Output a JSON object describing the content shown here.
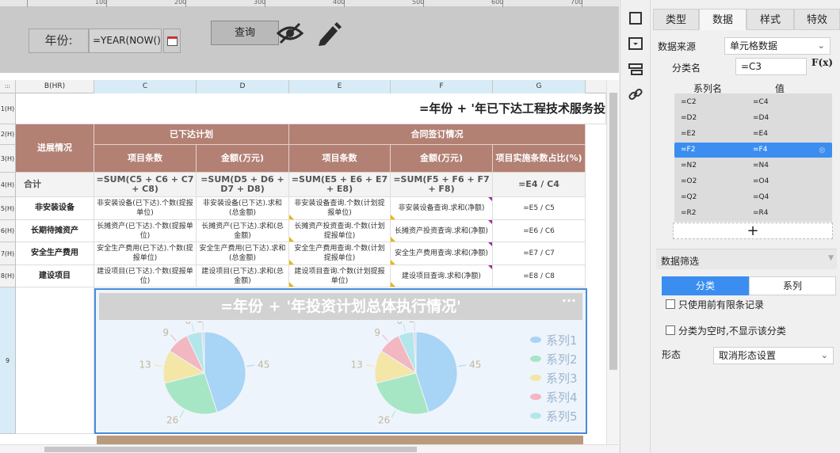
{
  "ruler": {
    "labels": [
      "100",
      "200",
      "300",
      "400",
      "500",
      "600",
      "700"
    ]
  },
  "param": {
    "label": "年份:",
    "input_value": "=YEAR(NOW())",
    "query_button": "查询",
    "hide_icon": "eye-off-icon",
    "edit_icon": "pencil-icon",
    "calendar_icon": "calendar-icon"
  },
  "columns": [
    "B(HR)",
    "C",
    "D",
    "E",
    "F",
    "G"
  ],
  "row_headers": [
    "1(H)",
    "2(H)",
    "3(H)",
    "4(H)",
    "5(H)",
    "6(H)",
    "7(H)",
    "8(H)",
    "9"
  ],
  "table": {
    "title": "=年份 + '年已下达工程技术服务投",
    "h_progress": "进展情况",
    "h_issued": "已下达计划",
    "h_contract": "合同签订情况",
    "h_count1": "项目条数",
    "h_amount1": "金额(万元)",
    "h_count2": "项目条数",
    "h_amount2": "金额(万元)",
    "h_ratio": "项目实施条数占比(%)",
    "total": {
      "label": "合计",
      "c": "=SUM(C5 + C6 + C7 + C8)",
      "d": "=SUM(D5 + D6 + D7 + D8)",
      "e": "=SUM(E5 + E6 + E7 + E8)",
      "f": "=SUM(F5 + F6 + F7 + F8)",
      "g": "=E4 / C4"
    },
    "rows": [
      {
        "label": "非安装设备",
        "c": "非安装设备(已下达).个数(提报单位)",
        "d": "非安装设备(已下达).求和(总金额)",
        "e": "非安装设备查询.个数(计划提报单位)",
        "f": "非安装设备查询.求和(净额)",
        "g": "=E5 / C5"
      },
      {
        "label": "长期待摊资产",
        "c": "长摊资产(已下达).个数(提报单位)",
        "d": "长摊资产(已下达).求和(总金额)",
        "e": "长摊资产投资查询.个数(计划提报单位)",
        "f": "长摊资产投资查询.求和(净额)",
        "g": "=E6 / C6"
      },
      {
        "label": "安全生产费用",
        "c": "安全生产费用(已下达).个数(提报单位)",
        "d": "安全生产费用(已下达).求和(总金额)",
        "e": "安全生产费用查询.个数(计划提报单位)",
        "f": "安全生产费用查询.求和(净额)",
        "g": "=E7 / C7"
      },
      {
        "label": "建设项目",
        "c": "建设项目(已下达).个数(提报单位)",
        "d": "建设项目(已下达).求和(总金额)",
        "e": "建设项目查询.个数(计划提报单位)",
        "f": "建设项目查询.求和(净额)",
        "g": "=E8 / C8"
      }
    ]
  },
  "chart": {
    "title": "=年份 + '年投资计划总体执行情况'",
    "menu": "···"
  },
  "chart_data": [
    {
      "type": "pie",
      "values": [
        45,
        26,
        13,
        9,
        6,
        1
      ],
      "legend_position": "right",
      "legend": [
        "系列1",
        "系列2",
        "系列3",
        "系列4",
        "系列5"
      ],
      "colors": [
        "#a8d4f5",
        "#a6e6c4",
        "#f3e6a6",
        "#f2b7c0",
        "#b3e6ea",
        "#d7d7ef"
      ]
    },
    {
      "type": "pie",
      "values": [
        45,
        26,
        13,
        9,
        6,
        1
      ],
      "colors": [
        "#a8d4f5",
        "#a6e6c4",
        "#f3e6a6",
        "#f2b7c0",
        "#b3e6ea",
        "#d7d7ef"
      ]
    }
  ],
  "panel": {
    "tabs": [
      "类型",
      "数据",
      "样式",
      "特效"
    ],
    "active_tab": "数据",
    "source_label": "数据来源",
    "source_value": "单元格数据",
    "category_label": "分类名",
    "category_value": "=C3",
    "fx": "F(x)",
    "series_header_name": "系列名",
    "series_header_value": "值",
    "series": [
      {
        "name": "=C2",
        "value": "=C4"
      },
      {
        "name": "=D2",
        "value": "=D4"
      },
      {
        "name": "=E2",
        "value": "=E4"
      },
      {
        "name": "=F2",
        "value": "=F4"
      },
      {
        "name": "=N2",
        "value": "=N4"
      },
      {
        "name": "=O2",
        "value": "=O4"
      },
      {
        "name": "=Q2",
        "value": "=Q4"
      },
      {
        "name": "=R2",
        "value": "=R4"
      }
    ],
    "add": "+",
    "filter_title": "数据筛选",
    "seg_category": "分类",
    "seg_series": "系列",
    "opt1": "只使用前有限条记录",
    "opt2": "分类为空时,不显示该分类",
    "shape_label": "形态",
    "shape_value": "取消形态设置"
  },
  "colors": {
    "header": "#b38074",
    "accent": "#3b8ef0",
    "selection": "#4a8ad8"
  }
}
